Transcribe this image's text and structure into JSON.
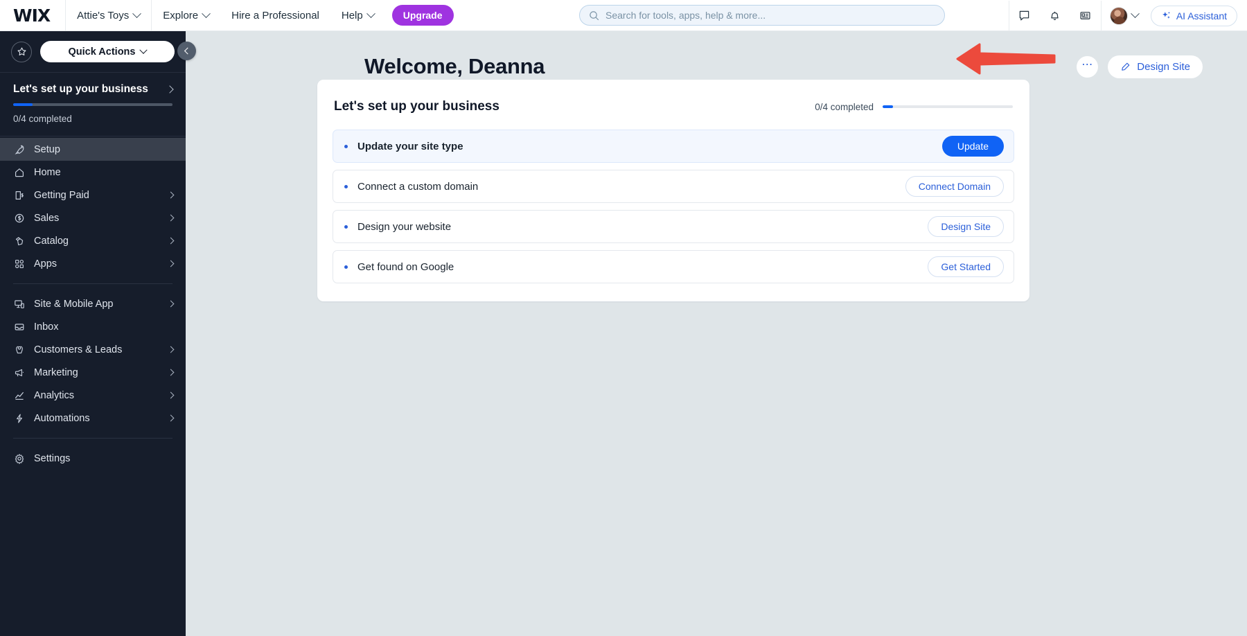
{
  "topbar": {
    "logo": "WIX",
    "site_selector": "Attie's Toys",
    "menus": [
      "Explore",
      "Hire a Professional",
      "Help"
    ],
    "explore_label": "Explore",
    "hire_label": "Hire a Professional",
    "help_label": "Help",
    "upgrade_label": "Upgrade",
    "search_placeholder": "Search for tools, apps, help & more...",
    "search_value": "",
    "search_icon": "search-icon",
    "icons": [
      "chat-icon",
      "bell-icon",
      "news-icon"
    ],
    "ai_assistant_label": "AI Assistant",
    "ai_icon": "sparkle-icon",
    "avatar": "user-avatar"
  },
  "sidebar": {
    "star_icon": "star-icon",
    "quick_actions_label": "Quick Actions",
    "setup": {
      "title": "Let's set up your business",
      "progress_percent": 12,
      "completed_label": "0/4 completed"
    },
    "collapse_icon": "chevron-left-icon",
    "items": [
      {
        "label": "Setup",
        "icon": "rocket-icon",
        "active": true,
        "chevron": false
      },
      {
        "label": "Home",
        "icon": "home-icon",
        "active": false,
        "chevron": false
      },
      {
        "label": "Getting Paid",
        "icon": "receipt-icon",
        "active": false,
        "chevron": true
      },
      {
        "label": "Sales",
        "icon": "dollar-icon",
        "active": false,
        "chevron": true
      },
      {
        "label": "Catalog",
        "icon": "catalog-icon",
        "active": false,
        "chevron": true
      },
      {
        "label": "Apps",
        "icon": "apps-icon",
        "active": false,
        "chevron": true
      },
      {
        "label": "Site & Mobile App",
        "icon": "monitor-icon",
        "active": false,
        "chevron": true,
        "separator_before": true
      },
      {
        "label": "Inbox",
        "icon": "inbox-icon",
        "active": false,
        "chevron": false
      },
      {
        "label": "Customers & Leads",
        "icon": "people-icon",
        "active": false,
        "chevron": true
      },
      {
        "label": "Marketing",
        "icon": "megaphone-icon",
        "active": false,
        "chevron": true
      },
      {
        "label": "Analytics",
        "icon": "chart-icon",
        "active": false,
        "chevron": true
      },
      {
        "label": "Automations",
        "icon": "bolt-icon",
        "active": false,
        "chevron": true
      },
      {
        "label": "Settings",
        "icon": "gear-icon",
        "active": false,
        "chevron": false,
        "separator_before": true
      }
    ]
  },
  "main": {
    "page_title": "Welcome, Deanna",
    "more_options_label": "⋯",
    "design_site_label": "Design Site",
    "design_site_icon": "pencil-icon",
    "card": {
      "title": "Let's set up your business",
      "progress_label": "0/4 completed",
      "progress_percent": 8,
      "tasks": [
        {
          "label": "Update your site type",
          "action": "Update",
          "style": "primary",
          "highlight": true
        },
        {
          "label": "Connect a custom domain",
          "action": "Connect Domain",
          "style": "ghost",
          "highlight": false
        },
        {
          "label": "Design your website",
          "action": "Design Site",
          "style": "ghost",
          "highlight": false
        },
        {
          "label": "Get found on Google",
          "action": "Get Started",
          "style": "ghost",
          "highlight": false
        }
      ]
    }
  },
  "annotation": {
    "type": "arrow",
    "color": "#ec4a3c",
    "points_to": "design-site-button"
  },
  "colors": {
    "accent_blue": "#1063f5",
    "link_blue": "#2b5fd9",
    "upgrade_purple": "#9f33e0",
    "sidebar_bg": "#161d2b",
    "page_bg": "#dfe5e8",
    "annotation_red": "#ec4a3c"
  }
}
